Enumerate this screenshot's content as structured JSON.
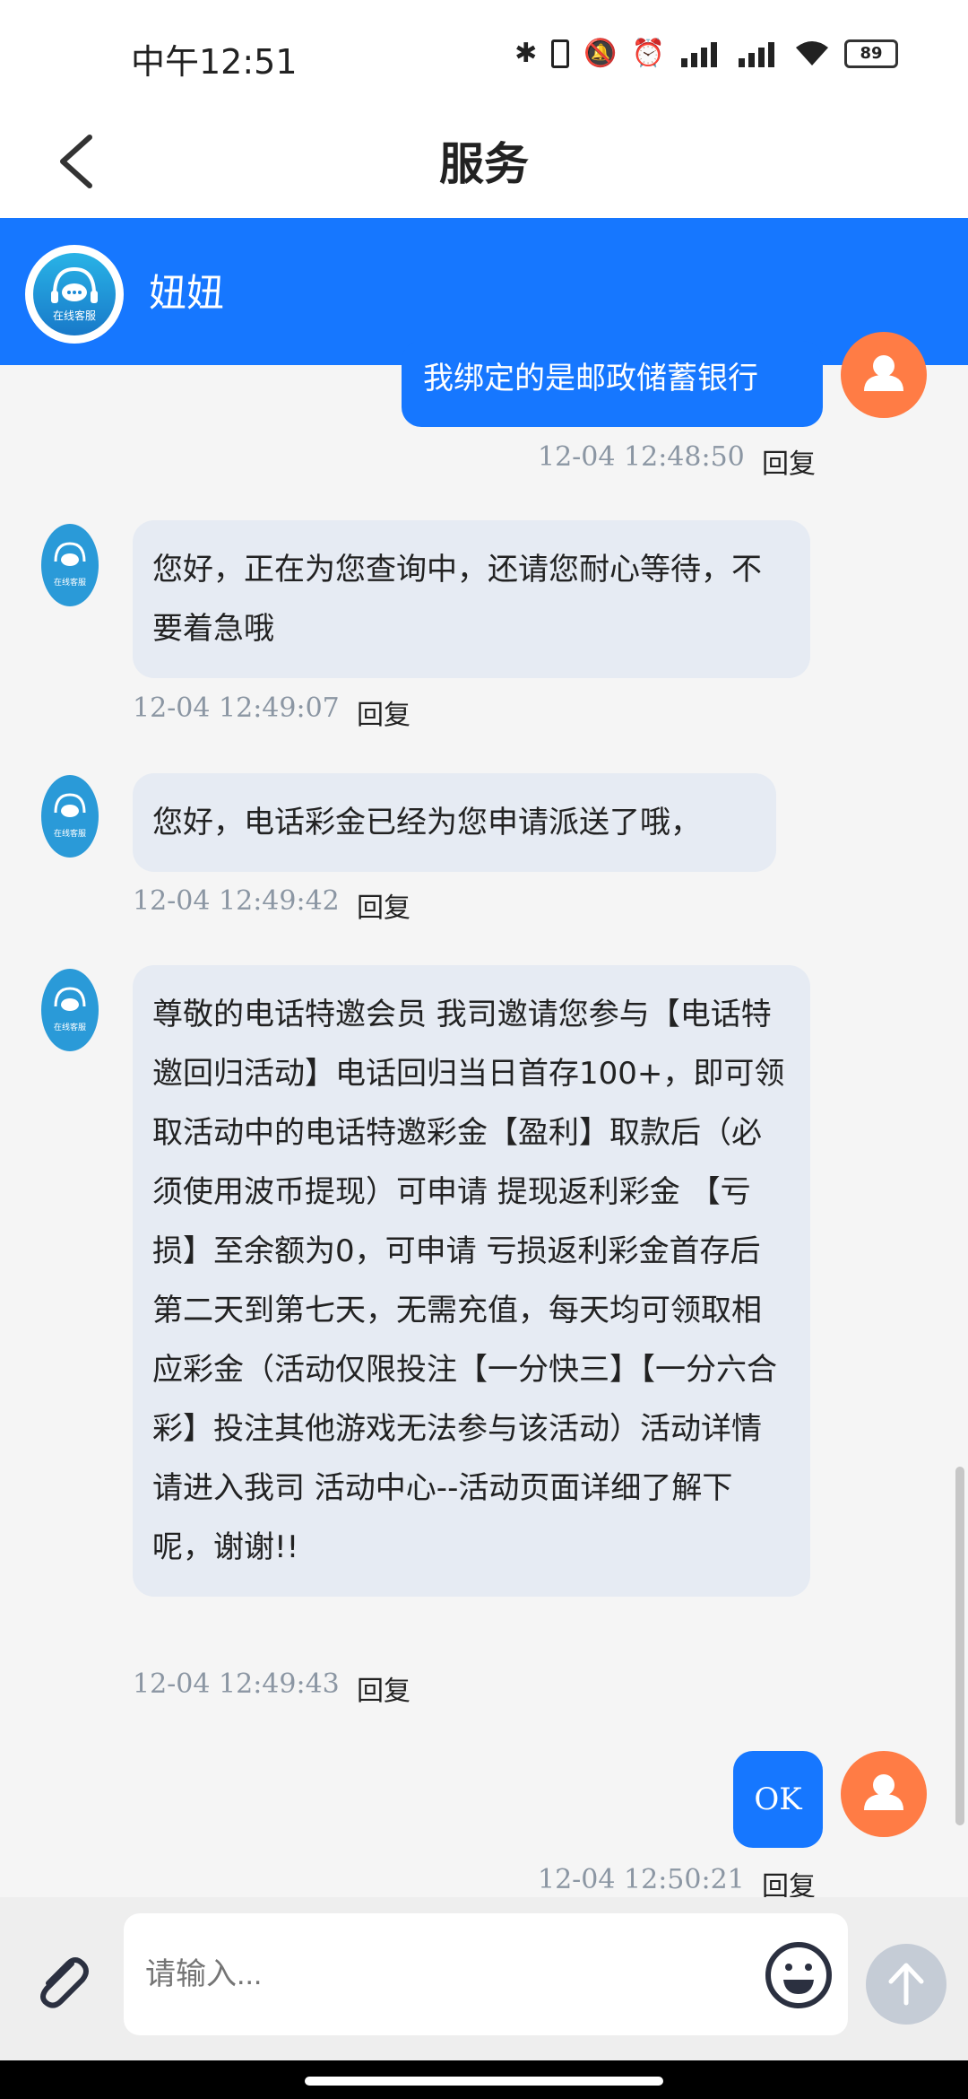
{
  "status_bar": {
    "time": "中午12:51",
    "battery": "89",
    "icons": [
      "bluetooth-icon",
      "vibrate-icon",
      "mute-icon",
      "alarm-icon",
      "signal-icon",
      "signal-icon",
      "wifi-icon",
      "battery-icon"
    ]
  },
  "header": {
    "title": "服务",
    "back_icon": "chevron-left-icon"
  },
  "agent": {
    "name": "妞妞",
    "avatar_caption": "在线客服"
  },
  "messages": [
    {
      "sender": "user",
      "text": "我绑定的是邮政储蓄银行",
      "time": "12-04 12:48:50",
      "reply": "回复"
    },
    {
      "sender": "agent",
      "text": "您好，正在为您查询中，还请您耐心等待，不要着急哦",
      "time": "12-04 12:49:07",
      "reply": "回复"
    },
    {
      "sender": "agent",
      "text": "您好，电话彩金已经为您申请派送了哦，",
      "time": "12-04 12:49:42",
      "reply": "回复"
    },
    {
      "sender": "agent",
      "text": "尊敬的电话特邀会员 我司邀请您参与【电话特邀回归活动】电话回归当日首存100+，即可领取活动中的电话特邀彩金【盈利】取款后（必须使用波币提现）可申请 提现返利彩金 【亏损】至余额为0，可申请 亏损返利彩金首存后第二天到第七天，无需充值，每天均可领取相应彩金（活动仅限投注【一分快三】【一分六合彩】投注其他游戏无法参与该活动）活动详情请进入我司 活动中心--活动页面详细了解下呢，谢谢!!",
      "time": "12-04 12:49:43",
      "reply": "回复"
    },
    {
      "sender": "user",
      "text": "OK",
      "time": "12-04 12:50:21",
      "reply": "回复"
    }
  ],
  "composer": {
    "placeholder": "请输入...",
    "attach_icon": "paperclip-icon",
    "emoji_icon": "emoji-icon",
    "send_icon": "arrow-up-icon"
  },
  "colors": {
    "accent": "#1677ff",
    "user_avatar": "#ff7c45",
    "agent_bubble": "#e6ebf3"
  }
}
